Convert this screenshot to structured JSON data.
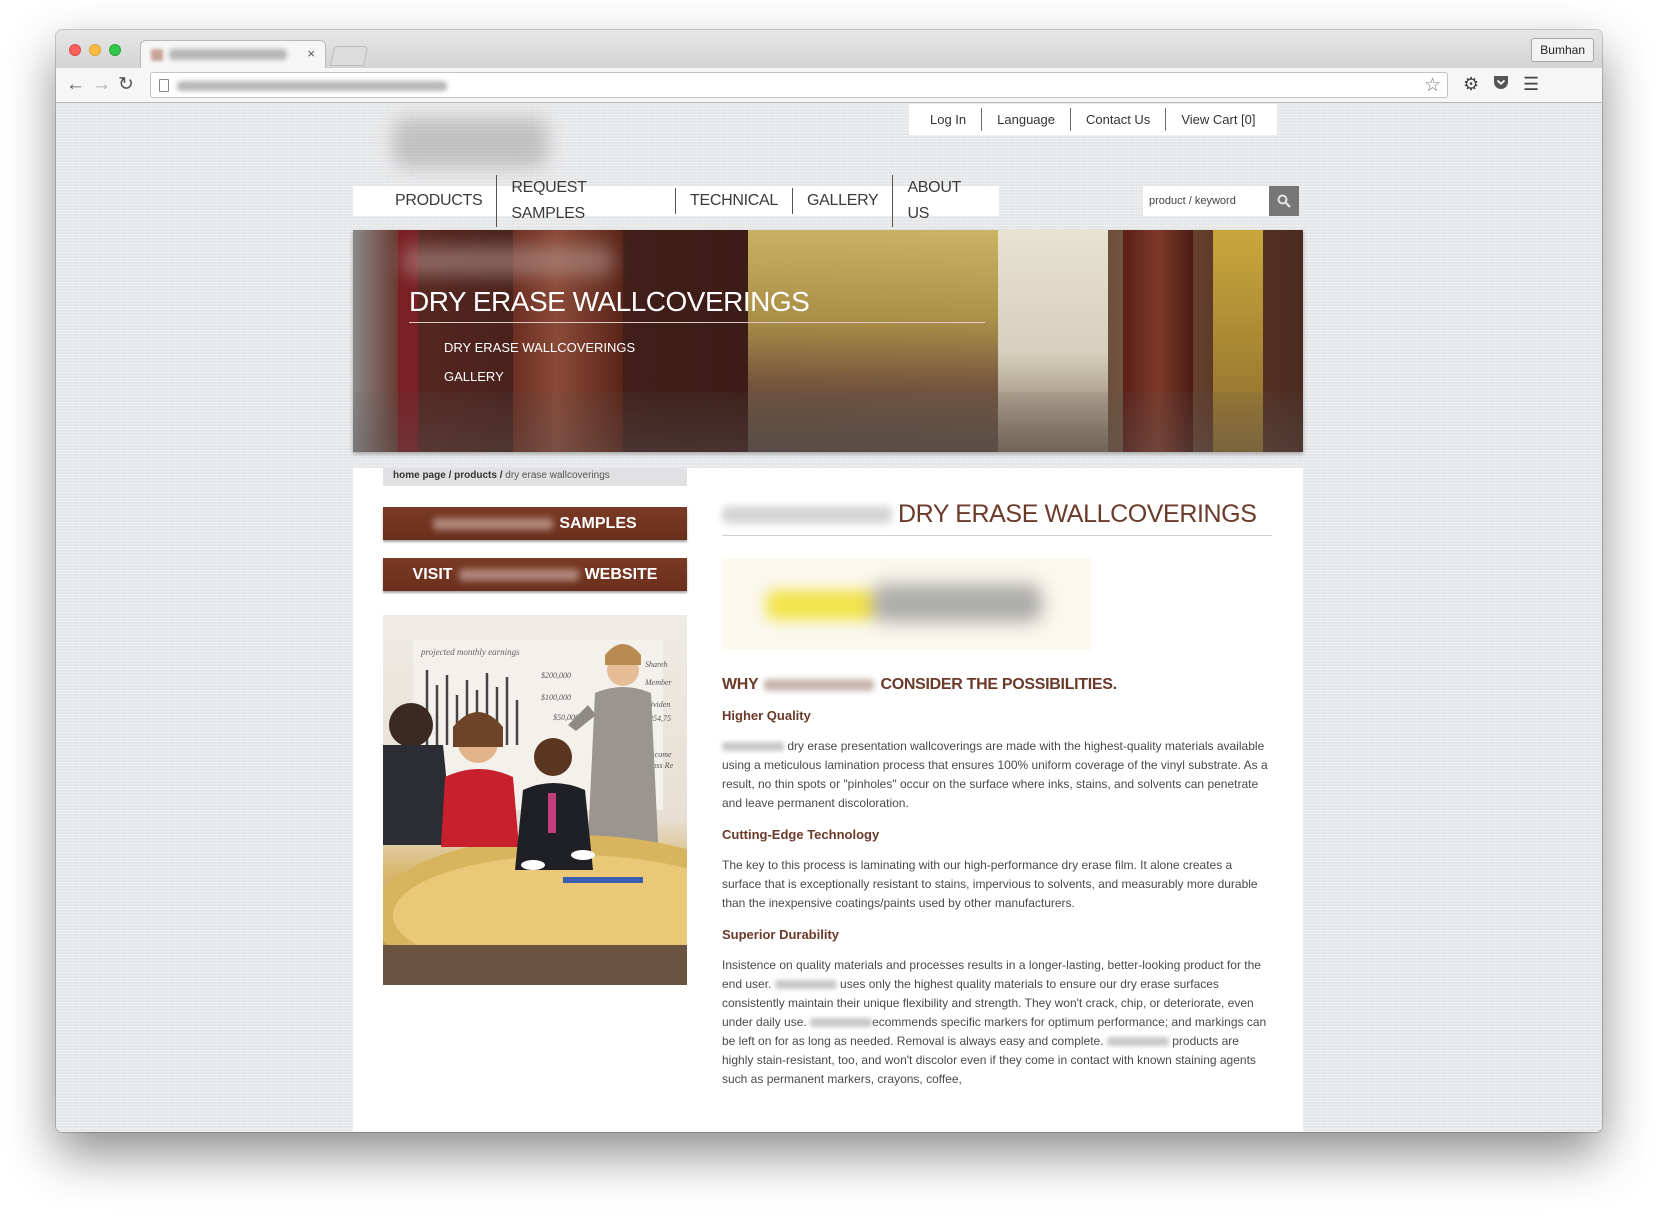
{
  "browser": {
    "profile_name": "Bumhan",
    "tab_close": "×"
  },
  "site": {
    "util_links": [
      "Log In",
      "Language",
      "Contact Us",
      "View Cart [0]"
    ],
    "main_nav": [
      "PRODUCTS",
      "REQUEST SAMPLES",
      "TECHNICAL",
      "GALLERY",
      "ABOUT US"
    ],
    "search_placeholder": "product / keyword",
    "hero": {
      "title": "DRY ERASE WALLCOVERINGS",
      "links": [
        "DRY ERASE WALLCOVERINGS",
        "GALLERY"
      ]
    },
    "breadcrumb": {
      "home": "home page",
      "section": "products",
      "current": "dry erase wallcoverings",
      "separator": " / "
    },
    "cta": {
      "samples_suffix": "SAMPLES",
      "visit_prefix": "VISIT",
      "visit_suffix": "WEBSITE"
    },
    "article": {
      "title": "DRY ERASE WALLCOVERINGS",
      "why_prefix": "WHY",
      "why_suffix": "CONSIDER THE POSSIBILITIES.",
      "sections": [
        {
          "heading": "Higher Quality",
          "text_after_brand": " dry erase presentation wallcoverings are made with the highest-quality materials available using a meticulous lamination process that ensures 100% uniform coverage of the vinyl substrate. As a result, no thin spots or \"pinholes\" occur on the surface where inks, stains, and solvents can penetrate and leave permanent discoloration."
        },
        {
          "heading": "Cutting-Edge Technology",
          "text": "The key to this process is laminating with our high-performance dry erase film. It alone creates a surface that is exceptionally resistant to stains, impervious to solvents, and measurably more durable than the inexpensive coatings/paints used by other manufacturers."
        },
        {
          "heading": "Superior Durability",
          "text_1": "Insistence on quality materials and processes results in a longer-lasting, better-looking product for the end user. ",
          "text_2": " uses only the highest quality materials to ensure our dry erase surfaces consistently maintain their unique flexibility and strength. They won't crack, chip, or deteriorate, even under daily use. ",
          "text_3": "ecommends specific markers for optimum performance; and markings can be left on for as long as needed. Removal is always easy and complete. ",
          "text_4": " products are highly stain-resistant, too, and won't discolor even if they come in contact with known staining agents such as permanent markers, crayons, coffee,"
        }
      ]
    },
    "photo_board": {
      "heading": "projected monthly earnings",
      "values": [
        "$200,000",
        "$100,000",
        "$50,000"
      ],
      "side": [
        "Shareh",
        "Member",
        "Dividen",
        "$354,75",
        "Income",
        "Loss Re"
      ]
    }
  }
}
